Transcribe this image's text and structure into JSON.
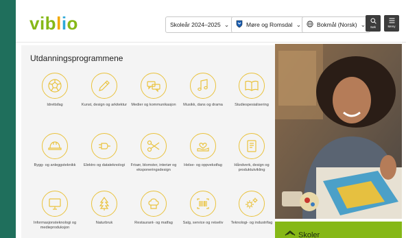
{
  "header": {
    "logo": {
      "part1": "vib",
      "part2": "l",
      "part3": "i",
      "part4": "o"
    },
    "school_year": "Skoleår 2024–2025",
    "county": "Møre og Romsdal",
    "language": "Bokmål (Norsk)",
    "search_label": "Søk",
    "menu_label": "Meny"
  },
  "main": {
    "title": "Utdanningsprogrammene",
    "programs": [
      {
        "label": "Idrettsfag",
        "icon": "ball-icon"
      },
      {
        "label": "Kunst, design og arkitektur",
        "icon": "pencil-icon"
      },
      {
        "label": "Medier og kommunikasjon",
        "icon": "speech-bubbles-icon"
      },
      {
        "label": "Musikk, dans og drama",
        "icon": "music-note-icon"
      },
      {
        "label": "Studiespesialisering",
        "icon": "book-icon"
      },
      {
        "label": "Bygg- og anleggsteknikk",
        "icon": "helmet-icon"
      },
      {
        "label": "Elektro og datateknologi",
        "icon": "plug-icon"
      },
      {
        "label": "Frisør, blomster, interiør og eksponeringsdesign",
        "icon": "scissors-icon"
      },
      {
        "label": "Helse- og oppvekstfag",
        "icon": "heart-hand-icon"
      },
      {
        "label": "Håndverk, design og produktutvikling",
        "icon": "scroll-icon"
      },
      {
        "label": "Informasjonsteknologi og medieproduksjon",
        "icon": "monitor-icon"
      },
      {
        "label": "Naturbruk",
        "icon": "tree-icon"
      },
      {
        "label": "Restaurant- og matfag",
        "icon": "chef-hat-icon"
      },
      {
        "label": "Salg, service og reiseliv",
        "icon": "barcode-icon"
      },
      {
        "label": "Teknologi- og industrifag",
        "icon": "gears-icon"
      }
    ]
  },
  "sidebar": {
    "card_label": "Skoler"
  },
  "colors": {
    "background": "#1f6f5c",
    "accent_yellow": "#e9c23d",
    "accent_green": "#86b817",
    "dark_button": "#3c3c3c"
  }
}
